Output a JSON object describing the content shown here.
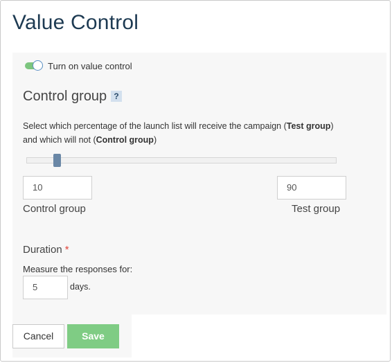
{
  "dialog": {
    "title": "Value Control"
  },
  "toggle": {
    "label": "Turn on value control",
    "enabled": true
  },
  "control_group": {
    "heading": "Control group",
    "help_icon_glyph": "?",
    "description_parts": {
      "part1": "Select which percentage of the launch list will receive the campaign (",
      "bold1": "Test group",
      "part2": ") and which will not (",
      "bold2": "Control group",
      "part3": ")"
    },
    "slider_percent": 10,
    "control_value": "10",
    "control_label": "Control group",
    "test_value": "90",
    "test_label": "Test group"
  },
  "duration": {
    "label": "Duration",
    "required_marker": "*",
    "measure_text": "Measure the responses for:",
    "days_value": "5",
    "days_unit": "days."
  },
  "actions": {
    "cancel_label": "Cancel",
    "save_label": "Save"
  },
  "colors": {
    "accent_green": "#7fcc84",
    "toggle_on": "#7cc57e",
    "title": "#1d3a52",
    "required": "#e0443a",
    "slider_handle": "#6a87a6"
  }
}
